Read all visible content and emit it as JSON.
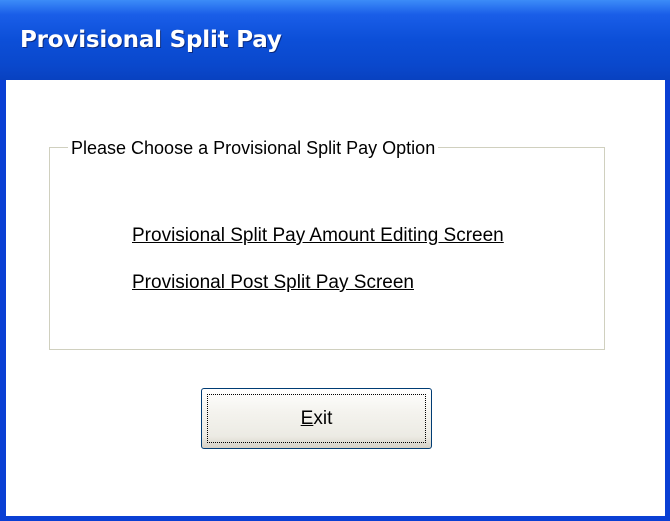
{
  "window": {
    "title": "Provisional Split Pay"
  },
  "group": {
    "legend": "Please Choose a Provisional Split Pay Option",
    "links": [
      "Provisional Split Pay Amount Editing Screen",
      "Provisional Post Split Pay Screen"
    ]
  },
  "exit_button": {
    "mnemonic": "E",
    "rest": "xit"
  },
  "colors": {
    "titlebar": "#0c4fd8",
    "window_frame": "#0a3fd4",
    "client_background": "#ffffff",
    "groupbox_border": "#d0d0bf"
  }
}
